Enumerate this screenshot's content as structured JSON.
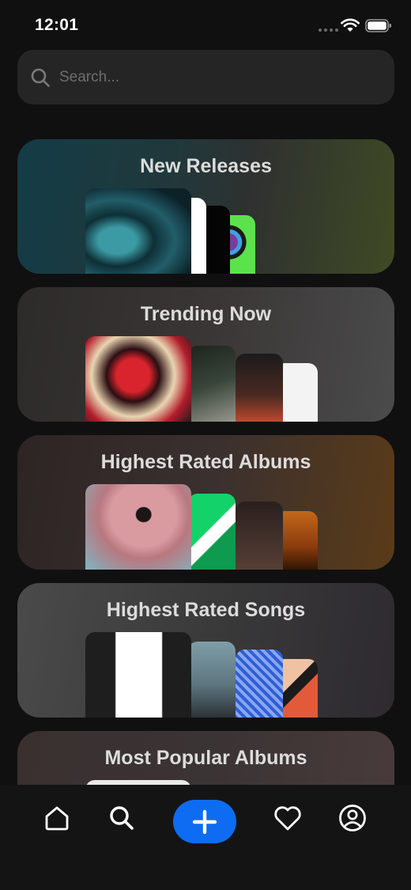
{
  "status": {
    "time": "12:01"
  },
  "search": {
    "placeholder": "Search..."
  },
  "sections": [
    {
      "title": "New Releases"
    },
    {
      "title": "Trending Now"
    },
    {
      "title": "Highest Rated Albums"
    },
    {
      "title": "Highest Rated Songs"
    },
    {
      "title": "Most Popular Albums"
    }
  ],
  "colors": {
    "accent": "#0d6cf2",
    "background": "#101010",
    "card_title": "#dcdcdc"
  },
  "tab_bar": {
    "items": [
      "home-icon",
      "search-icon",
      "plus-icon",
      "heart-icon",
      "profile-icon"
    ]
  }
}
